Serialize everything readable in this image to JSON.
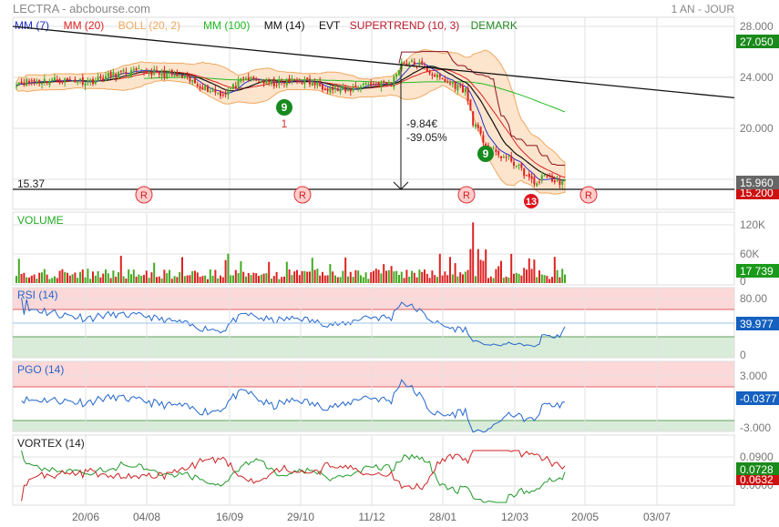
{
  "header": {
    "title": "LECTRA - abcbourse.com",
    "period": "1 AN - JOUR"
  },
  "legend": [
    {
      "label": "MM (7)",
      "color": "#2233cc"
    },
    {
      "label": "MM (20)",
      "color": "#dd2222"
    },
    {
      "label": "BOLL (20, 2)",
      "color": "#f0a860"
    },
    {
      "label": "MM (100)",
      "color": "#22bb22"
    },
    {
      "label": "MM (14)",
      "color": "#111111"
    },
    {
      "label": "EVT",
      "color": "#111111"
    },
    {
      "label": "SUPERTREND (10, 3)",
      "color": "#bb1a2a"
    },
    {
      "label": "DEMARK",
      "color": "#228822"
    }
  ],
  "annotations": {
    "support_level": "15.37",
    "drop_value": "-9.84€",
    "drop_pct": "-39.05%",
    "reversal_marker": "R",
    "demark_9": "9",
    "demark_13": "13",
    "demark_1": "1"
  },
  "price_tags": {
    "high": "27.050",
    "last": "15.960",
    "low": "15.200"
  },
  "panels": {
    "volume": {
      "label": "VOLUME",
      "last": "17 739",
      "ticks": [
        "120K",
        "60K",
        "0"
      ]
    },
    "rsi": {
      "label": "RSI (14)",
      "last": "39.977",
      "ticks": [
        "80.00",
        "0"
      ]
    },
    "pgo": {
      "label": "PGO (14)",
      "last": "-0.0377",
      "ticks": [
        "3.000",
        "-3.000"
      ]
    },
    "vortex": {
      "label": "VORTEX (14)",
      "last_plus": "0.0728",
      "last_minus": "0.0632",
      "ticks": [
        "0.0900",
        "0.0000"
      ]
    }
  },
  "chart_data": {
    "type": "candlestick",
    "title": "LECTRA",
    "price_ticks": [
      "28.000",
      "24.000",
      "20.000"
    ],
    "ylim": [
      15,
      28.5
    ],
    "x_ticks": [
      "20/06",
      "04/08",
      "16/09",
      "29/10",
      "11/12",
      "28/01",
      "12/03",
      "20/05",
      "03/07"
    ],
    "close_anchors": [
      [
        0,
        23.6
      ],
      [
        15,
        23.8
      ],
      [
        29,
        23.7
      ],
      [
        40,
        24.3
      ],
      [
        51,
        24.5
      ],
      [
        65,
        24.0
      ],
      [
        76,
        23.0
      ],
      [
        81,
        22.7
      ],
      [
        90,
        23.9
      ],
      [
        101,
        23.5
      ],
      [
        111,
        23.8
      ],
      [
        122,
        23.2
      ],
      [
        129,
        22.9
      ],
      [
        136,
        23.5
      ],
      [
        147,
        23.5
      ],
      [
        151,
        25.2
      ],
      [
        158,
        25.0
      ],
      [
        165,
        24.0
      ],
      [
        176,
        23.0
      ],
      [
        179,
        20.5
      ],
      [
        183,
        19.0
      ],
      [
        188,
        18.0
      ],
      [
        194,
        17.5
      ],
      [
        199,
        16.5
      ],
      [
        203,
        15.6
      ],
      [
        208,
        16.4
      ],
      [
        211,
        15.7
      ],
      [
        215,
        15.96
      ]
    ],
    "trendline": [
      28.0,
      22.4
    ],
    "volume_peak": 125000,
    "volume_last": 17739,
    "rsi_last": 39.977,
    "pgo_last": -0.0377
  }
}
